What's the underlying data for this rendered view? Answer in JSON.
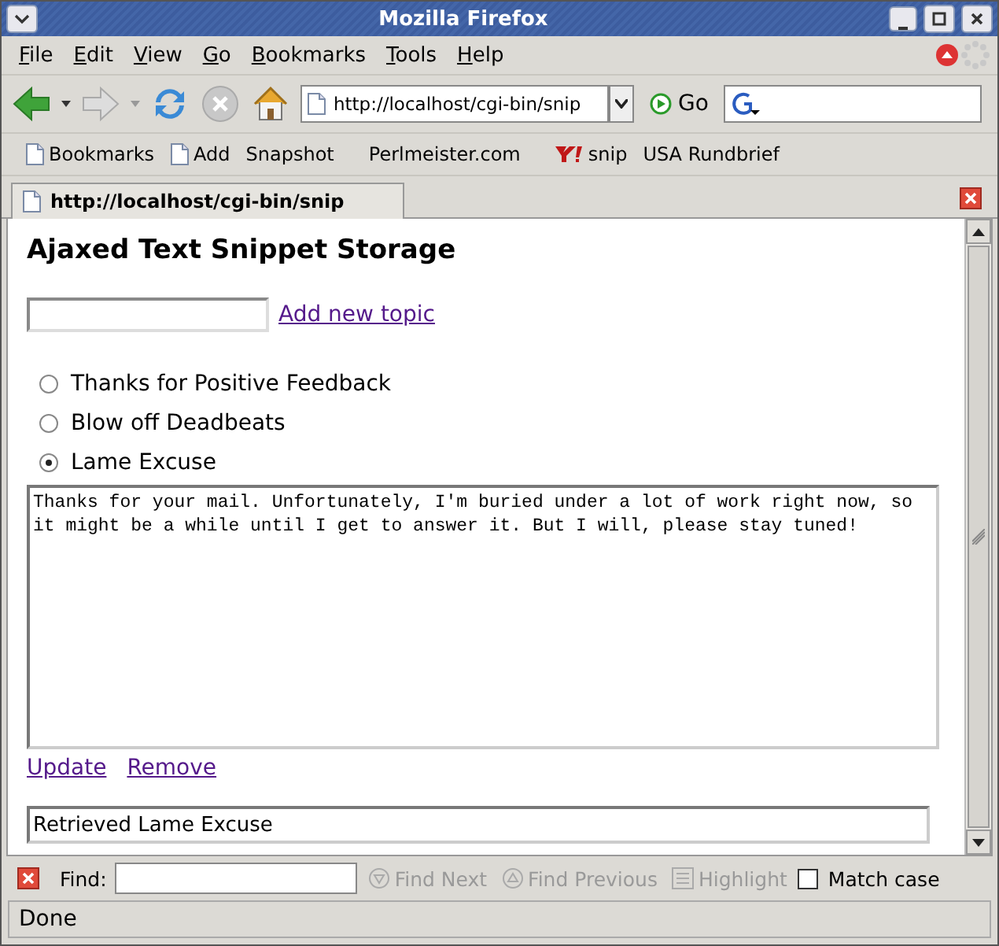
{
  "window": {
    "title": "Mozilla Firefox"
  },
  "menu": [
    {
      "label": "File"
    },
    {
      "label": "Edit"
    },
    {
      "label": "View"
    },
    {
      "label": "Go"
    },
    {
      "label": "Bookmarks"
    },
    {
      "label": "Tools"
    },
    {
      "label": "Help"
    }
  ],
  "toolbar": {
    "url": "http://localhost/cgi-bin/snip",
    "go": "Go"
  },
  "bookmarks": [
    {
      "label": "Bookmarks",
      "kind": "page"
    },
    {
      "label": "Add",
      "kind": "page"
    },
    {
      "label": "Snapshot",
      "kind": "plain"
    },
    {
      "label": "Perlmeister.com",
      "kind": "plain"
    },
    {
      "label": "snip",
      "kind": "yahoo"
    },
    {
      "label": "USA Rundbrief",
      "kind": "plain"
    }
  ],
  "tabs": [
    {
      "label": "http://localhost/cgi-bin/snip",
      "selected": true
    }
  ],
  "page": {
    "heading": "Ajaxed Text Snippet Storage",
    "add_link": "Add new topic",
    "topics": [
      {
        "label": "Thanks for Positive Feedback",
        "selected": false
      },
      {
        "label": "Blow off Deadbeats",
        "selected": false
      },
      {
        "label": "Lame Excuse",
        "selected": true
      }
    ],
    "snippet": "Thanks for your mail. Unfortunately, I'm buried under a lot of work right now, so it might be a while until I get to answer it. But I will, please stay tuned!",
    "links": [
      "Update",
      "Remove"
    ],
    "status_field": "Retrieved Lame Excuse"
  },
  "find_bar": {
    "label": "Find:",
    "buttons": [
      {
        "label": "Find Next",
        "kind": "next",
        "disabled": true
      },
      {
        "label": "Find Previous",
        "kind": "previous",
        "disabled": true
      },
      {
        "label": "Highlight",
        "kind": "highlight",
        "disabled": true
      }
    ],
    "match_case": {
      "label": "Match case",
      "checked": false
    }
  },
  "status_bar": "Done"
}
